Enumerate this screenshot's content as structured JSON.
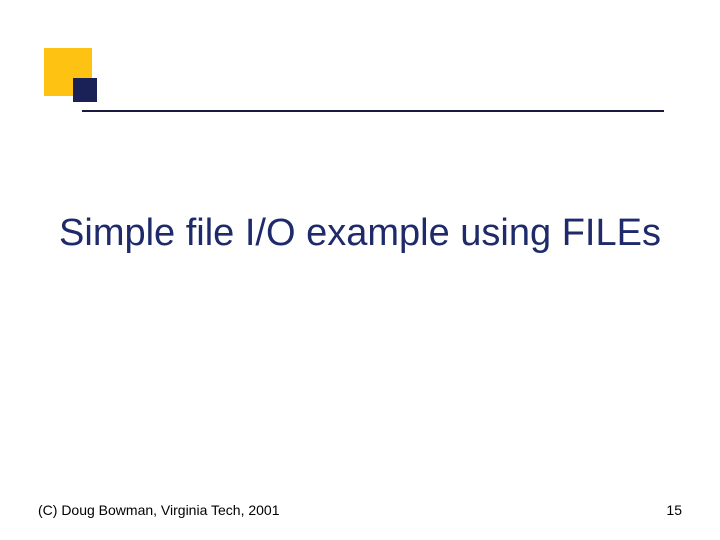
{
  "title": "Simple file I/O example using FILEs",
  "footer": {
    "copyright": "(C) Doug Bowman, Virginia Tech, 2001",
    "page": "15"
  },
  "colors": {
    "accent_yellow": "#fec312",
    "accent_navy": "#1a2156",
    "title_text": "#1f2a6a"
  }
}
